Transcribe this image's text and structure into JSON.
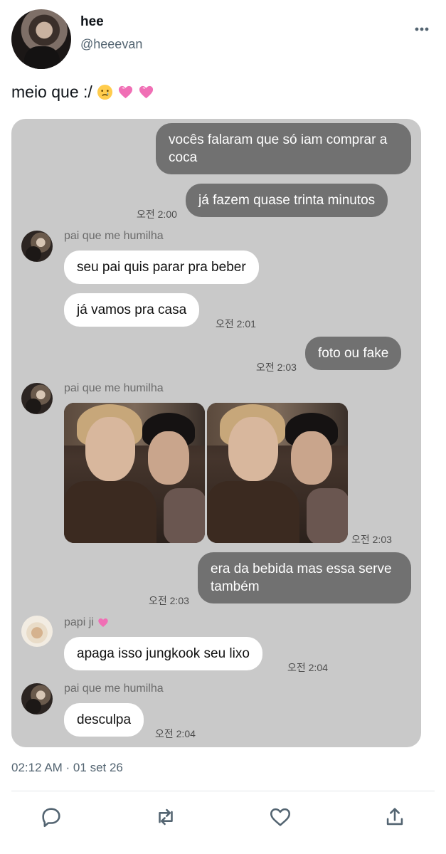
{
  "author": {
    "display_name": "hee",
    "handle": "@heeevan"
  },
  "tweet": {
    "text": "meio que :/",
    "emojis": [
      "crying-face",
      "pink-heart",
      "pink-heart"
    ],
    "timestamp": "02:12 AM · 01 set 26"
  },
  "chat": {
    "messages": [
      {
        "direction": "out",
        "text": "vocês falaram que só iam comprar a coca"
      },
      {
        "direction": "out",
        "text": "já fazem quase trinta minutos",
        "time": "오전 2:00"
      },
      {
        "direction": "in",
        "sender": "pai que me humilha",
        "text": "seu pai quis parar pra beber"
      },
      {
        "direction": "in",
        "text": "já vamos pra casa",
        "time": "오전 2:01"
      },
      {
        "direction": "out",
        "text": "foto ou fake",
        "time": "오전 2:03"
      },
      {
        "direction": "in",
        "sender": "pai que me humilha",
        "text": "[2 photos]",
        "time": "오전 2:03"
      },
      {
        "direction": "out",
        "text": "era da bebida mas essa serve também",
        "time": "오전 2:03"
      },
      {
        "direction": "in",
        "sender": "papi ji",
        "sender_emoji": "pink-heart",
        "text": "apaga isso jungkook seu lixo",
        "time": "오전 2:04"
      },
      {
        "direction": "in",
        "sender": "pai que me humilha",
        "text": "desculpa",
        "time": "오전 2:04"
      }
    ]
  },
  "colors": {
    "card_bg": "#c9c9c9",
    "outgoing_bubble": "#717171",
    "incoming_bubble": "#ffffff",
    "secondary_text": "#536471",
    "heart_pink": "#f06fb5"
  },
  "actions": [
    "reply-icon",
    "retweet-icon",
    "like-icon",
    "share-icon"
  ]
}
